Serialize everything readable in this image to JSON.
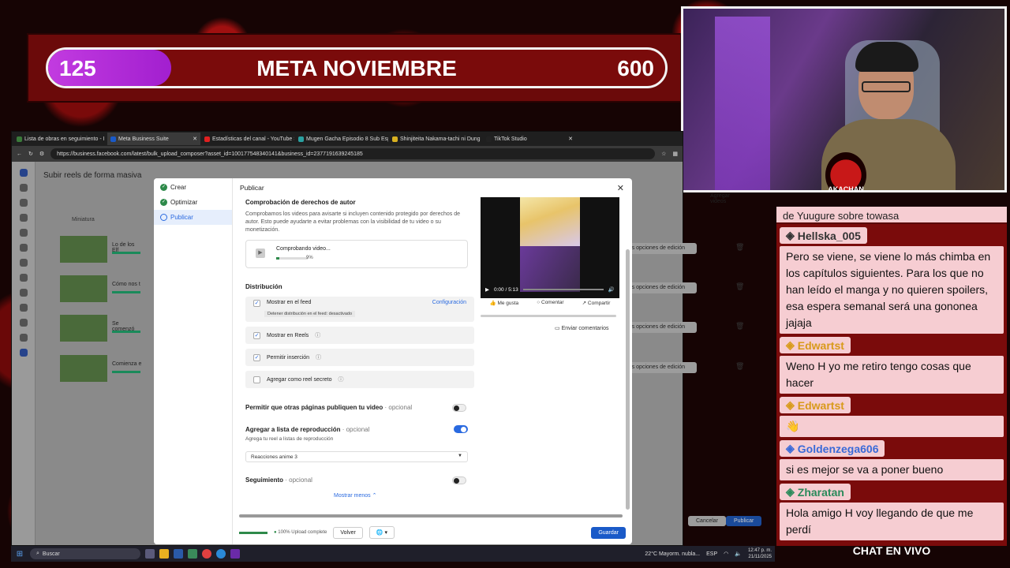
{
  "goal": {
    "start": "125",
    "title": "META NOVIEMBRE",
    "end": "600",
    "progress_fraction": 0.2
  },
  "browser": {
    "tabs": [
      {
        "label": "Lista de obras en seguimiento - I",
        "color": "#3a7a3a"
      },
      {
        "label": "Meta Business Suite",
        "color": "#1a5ac8",
        "active": true
      },
      {
        "label": "Estadísticas del canal - YouTube S",
        "color": "#e02020"
      },
      {
        "label": "Mugen Gacha Episodio 8 Sub Esp",
        "color": "#2aa0a0"
      },
      {
        "label": "Shinjiteita Nakama-tachi ni Dung",
        "color": "#d8b020"
      },
      {
        "label": "TikTok Studio",
        "color": "#222222"
      }
    ],
    "url": "https://business.facebook.com/latest/bulk_upload_composer?asset_id=100177548340141&business_id=2377191639245185"
  },
  "fb": {
    "page_title": "Subir reels de forma masiva",
    "column_header": "Miniatura",
    "add_videos": "Agregar videos",
    "rows": [
      {
        "title": "Lo de los Elf",
        "more": "Más opciones de edición"
      },
      {
        "title": "Cómo nos t",
        "more": "Más opciones de edición"
      },
      {
        "title": "Se comenzó",
        "more": "Más opciones de edición"
      },
      {
        "title": "Comienza e",
        "more": "Más opciones de edición"
      }
    ],
    "cancel": "Cancelar",
    "publish": "Publicar"
  },
  "modal": {
    "steps": [
      "Crear",
      "Optimizar",
      "Publicar"
    ],
    "header": "Publicar",
    "copyright_title": "Comprobación de derechos de autor",
    "copyright_desc": "Comprobamos los videos para avisarte si incluyen contenido protegido por derechos de autor. Esto puede ayudarte a evitar problemas con la visibilidad de tu video o su monetización.",
    "checking_label": "Comprobando video...",
    "checking_pct": "9%",
    "checking_progress": 0.09,
    "distribution_title": "Distribución",
    "show_in_feed": "Mostrar en el feed",
    "configuration": "Configuración",
    "feed_note": "Detener distribución en el feed: desactivado",
    "show_in_reels": "Mostrar en Reels",
    "allow_remix": "Permitir inserción",
    "secret_reel": "Agregar como reel secreto",
    "allow_pages": "Permitir que otras páginas publiquen tu video",
    "optional": "· opcional",
    "add_playlist": "Agregar a lista de reproducción",
    "playlist_hint": "Agrega tu reel a listas de reproducción",
    "playlist_value": "Reacciones anime 3",
    "follow": "Seguimiento",
    "show_less": "Mostrar menos ⌃",
    "player_time": "0:00 / 5:13",
    "like": "Me gusta",
    "comment": "Comentar",
    "share": "Compartir",
    "feedback": "Enviar comentarios",
    "upload_status": "100% Upload complete",
    "back": "Volver",
    "save": "Guardar"
  },
  "chat": {
    "top_text": "de Yuugure sobre towasa",
    "messages": [
      {
        "user": "Hellska_005",
        "text": "Pero se viene, se viene lo más chimba en los capítulos siguientes. Para los que no han leído el manga y no quieren spoilers, esa espera semanal será una gononea jajaja"
      },
      {
        "user": "Edwartst",
        "text": "Weno H yo me retiro tengo cosas que hacer"
      },
      {
        "user": "Edwartst",
        "text": "👋"
      },
      {
        "user": "Goldenzega606",
        "text": "si es mejor se va a poner bueno"
      },
      {
        "user": "Zharatan",
        "text": "Hola amigo H voy llegando de que me perdí"
      }
    ],
    "footer": "CHAT EN VIVO"
  },
  "webcam": {
    "badge": "AKACHAN"
  },
  "taskbar": {
    "search": "Buscar",
    "weather": "22°C Mayorm. nubla...",
    "lang": "ESP",
    "time": "12:47 p. m.",
    "date": "21/11/2025"
  }
}
